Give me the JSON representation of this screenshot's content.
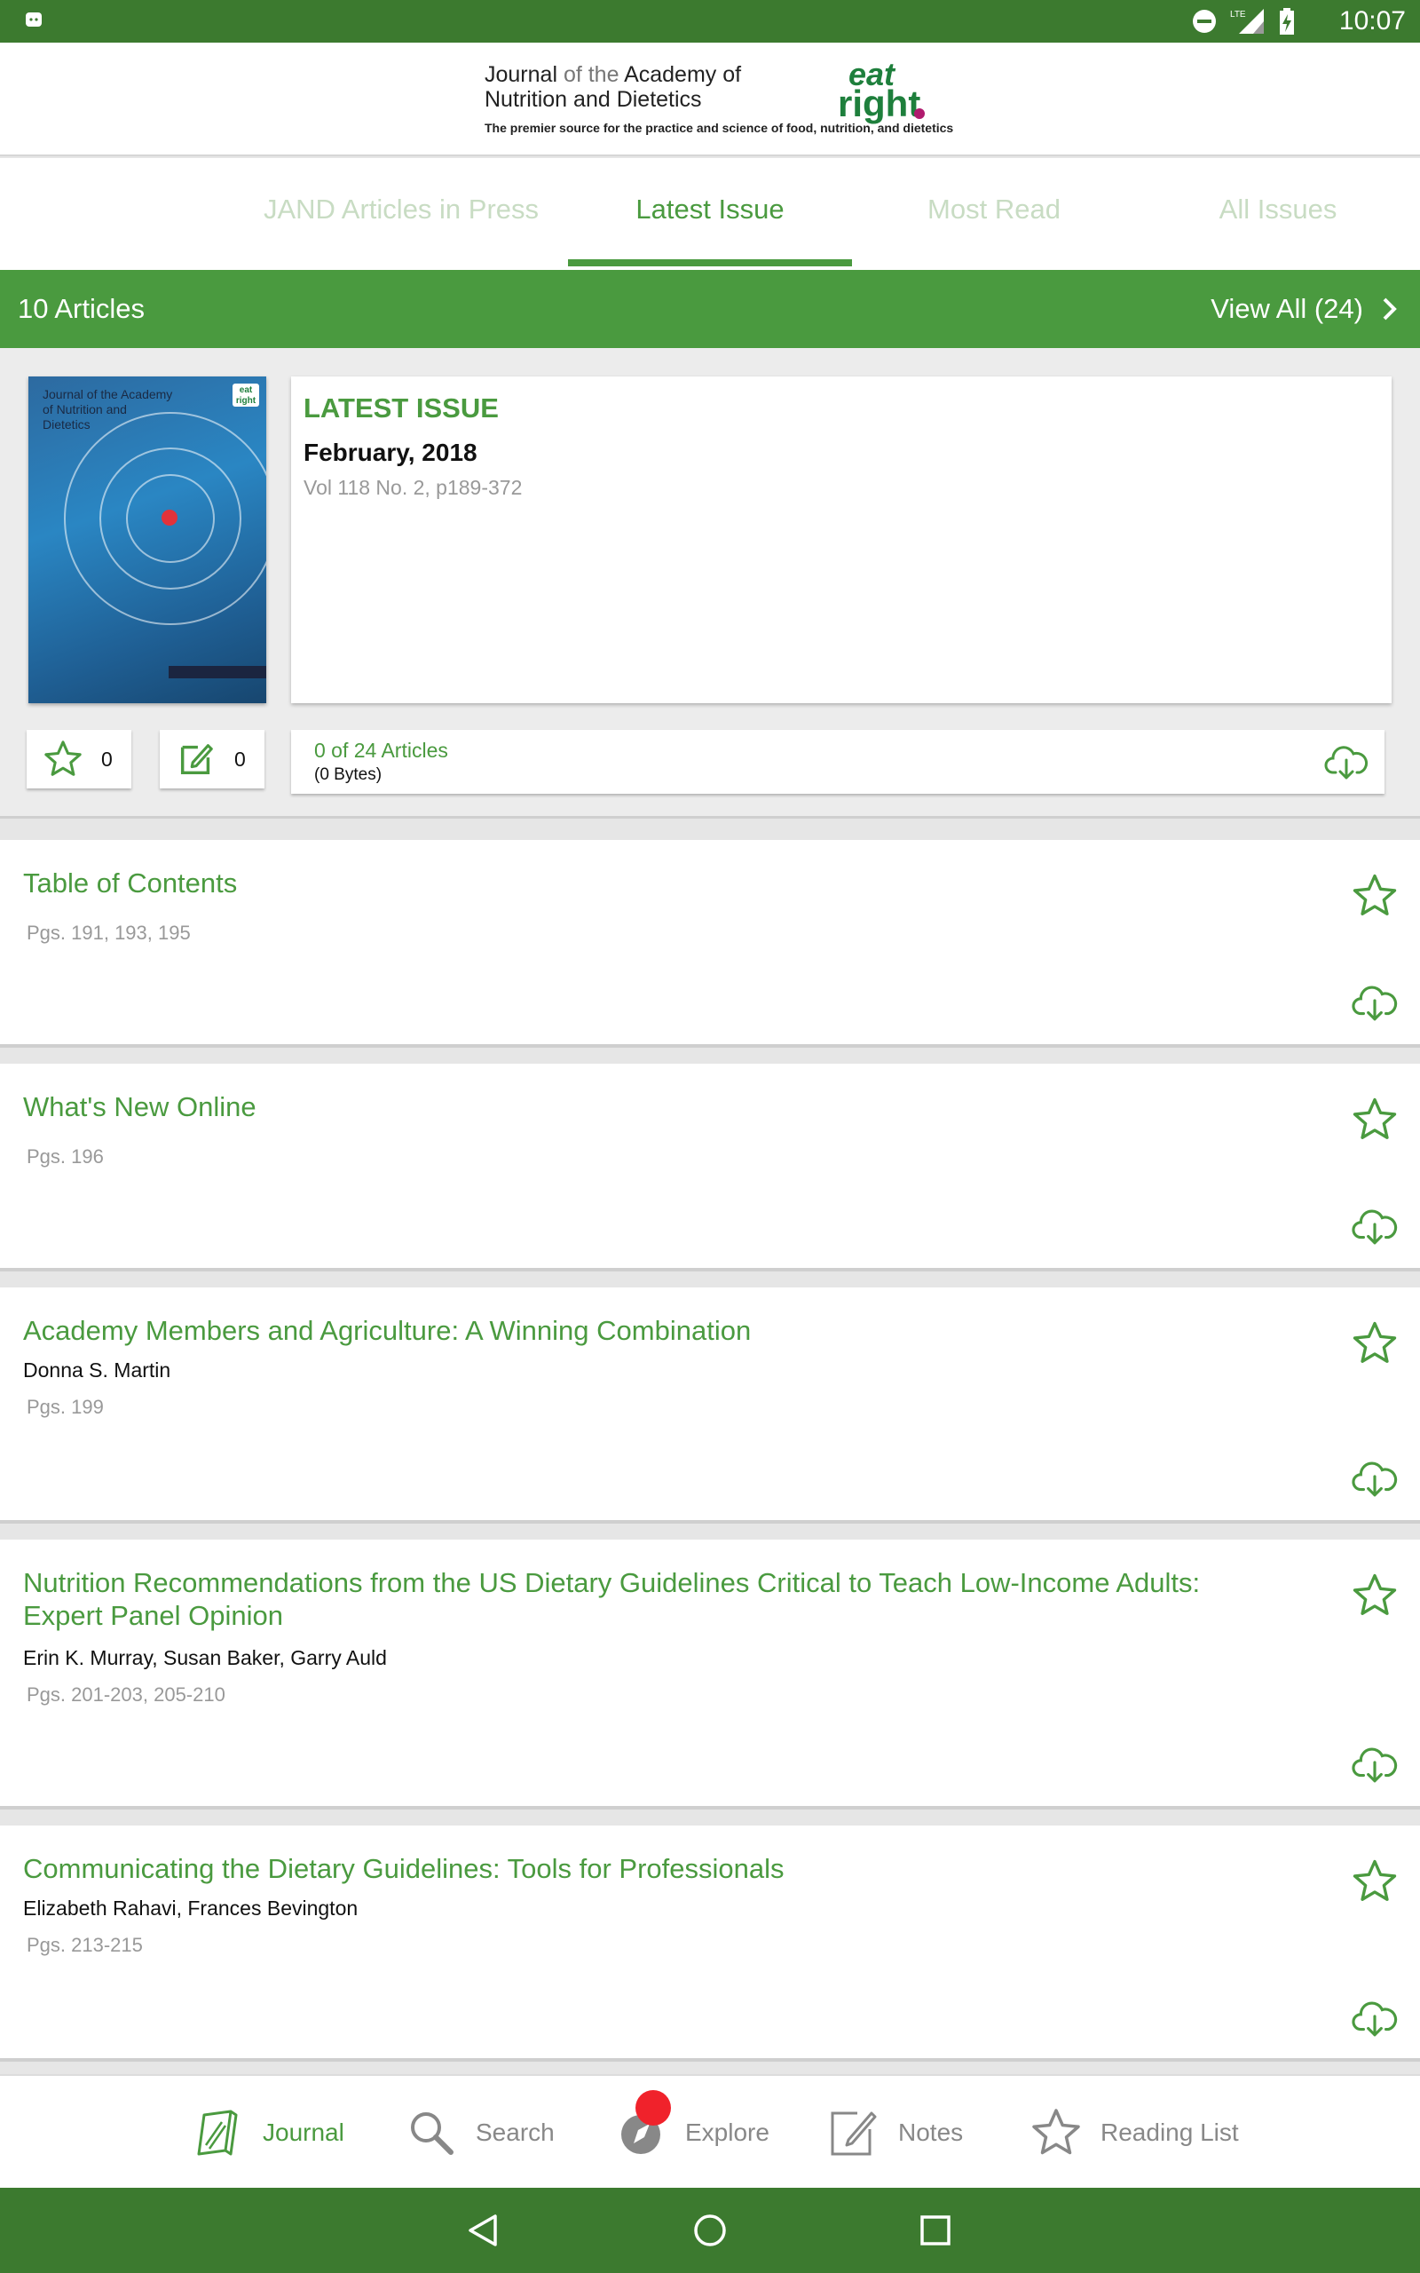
{
  "status_bar": {
    "time": "10:07",
    "icons": [
      "android-icon",
      "do-not-disturb-icon",
      "lte-icon",
      "signal-icon",
      "battery-charging-icon"
    ],
    "lte_label": "LTE"
  },
  "header": {
    "logo_line1_a": "Journal",
    "logo_line1_b": " of the ",
    "logo_line1_c": "Academy of",
    "logo_line2": "Nutrition and Dietetics",
    "logo_tagline": "The premier source for the practice and science of food, nutrition, and dietetics",
    "brand_eat": "eat",
    "brand_right": "right"
  },
  "tabs": [
    {
      "label": "JAND Articles in Press",
      "active": false
    },
    {
      "label": "Latest Issue",
      "active": true
    },
    {
      "label": "Most Read",
      "active": false
    },
    {
      "label": "All Issues",
      "active": false
    }
  ],
  "articles_bar": {
    "count_label": "10 Articles",
    "view_all_label": "View All (24)"
  },
  "issue": {
    "cover_title": "Journal of the Academy of Nutrition and Dietetics",
    "label": "LATEST ISSUE",
    "date": "February, 2018",
    "volume": "Vol 118 No. 2, p189-372",
    "starred_count": "0",
    "notes_count": "0",
    "download_count": "0 of 24 Articles",
    "download_size": "(0 Bytes)"
  },
  "articles": [
    {
      "title": "Table of Contents",
      "authors": "",
      "pages": "Pgs. 191, 193, 195"
    },
    {
      "title": "What's New Online",
      "authors": "",
      "pages": "Pgs. 196"
    },
    {
      "title": "Academy Members and Agriculture: A Winning Combination",
      "authors": "Donna S. Martin",
      "pages": "Pgs. 199"
    },
    {
      "title": "Nutrition Recommendations from the US Dietary Guidelines Critical to Teach Low-Income Adults: Expert Panel Opinion",
      "authors": "Erin K. Murray, Susan Baker, Garry Auld",
      "pages": "Pgs. 201-203, 205-210"
    },
    {
      "title": "Communicating the Dietary Guidelines: Tools for Professionals",
      "authors": "Elizabeth Rahavi, Frances Bevington",
      "pages": "Pgs. 213-215"
    }
  ],
  "bottom_nav": [
    {
      "label": "Journal",
      "icon": "journal-icon",
      "active": true
    },
    {
      "label": "Search",
      "icon": "search-icon",
      "active": false
    },
    {
      "label": "Explore",
      "icon": "explore-icon",
      "active": false
    },
    {
      "label": "Notes",
      "icon": "notes-icon",
      "active": false
    },
    {
      "label": "Reading List",
      "icon": "star-icon",
      "active": false
    }
  ],
  "colors": {
    "primary_green": "#4a9a3f",
    "dark_green": "#3c7a2f",
    "inactive_tab": "#c8dcc3",
    "badge_red": "#f0222b",
    "brand_green": "#1e7f3c"
  }
}
